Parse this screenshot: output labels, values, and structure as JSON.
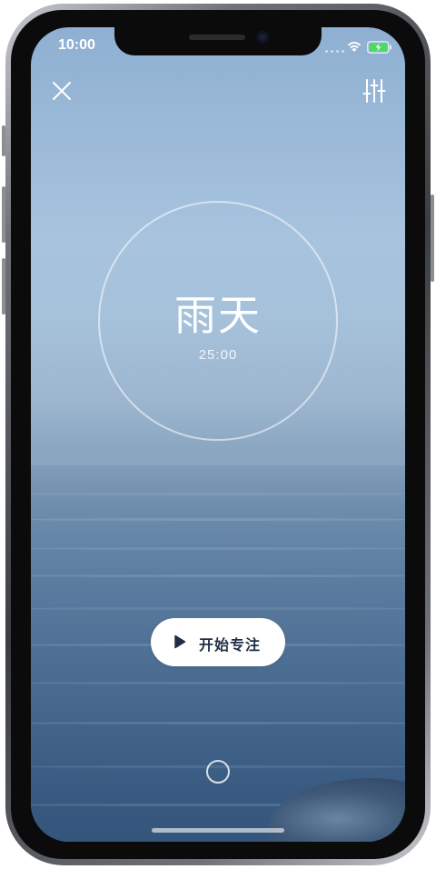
{
  "status_bar": {
    "time": "10:00"
  },
  "scene": {
    "title": "雨天",
    "timer": "25:00"
  },
  "actions": {
    "start_label": "开始专注"
  },
  "icons": {
    "close": "close-icon",
    "settings": "sliders-icon",
    "play": "play-icon",
    "wifi": "wifi-icon",
    "battery": "battery-charging-icon",
    "bottom": "circle-icon"
  },
  "colors": {
    "sky_top": "#8fb0d2",
    "sea_deep": "#34557b",
    "button_bg": "#ffffff",
    "button_text": "#1e2f45",
    "battery_fill": "#4cd964"
  }
}
